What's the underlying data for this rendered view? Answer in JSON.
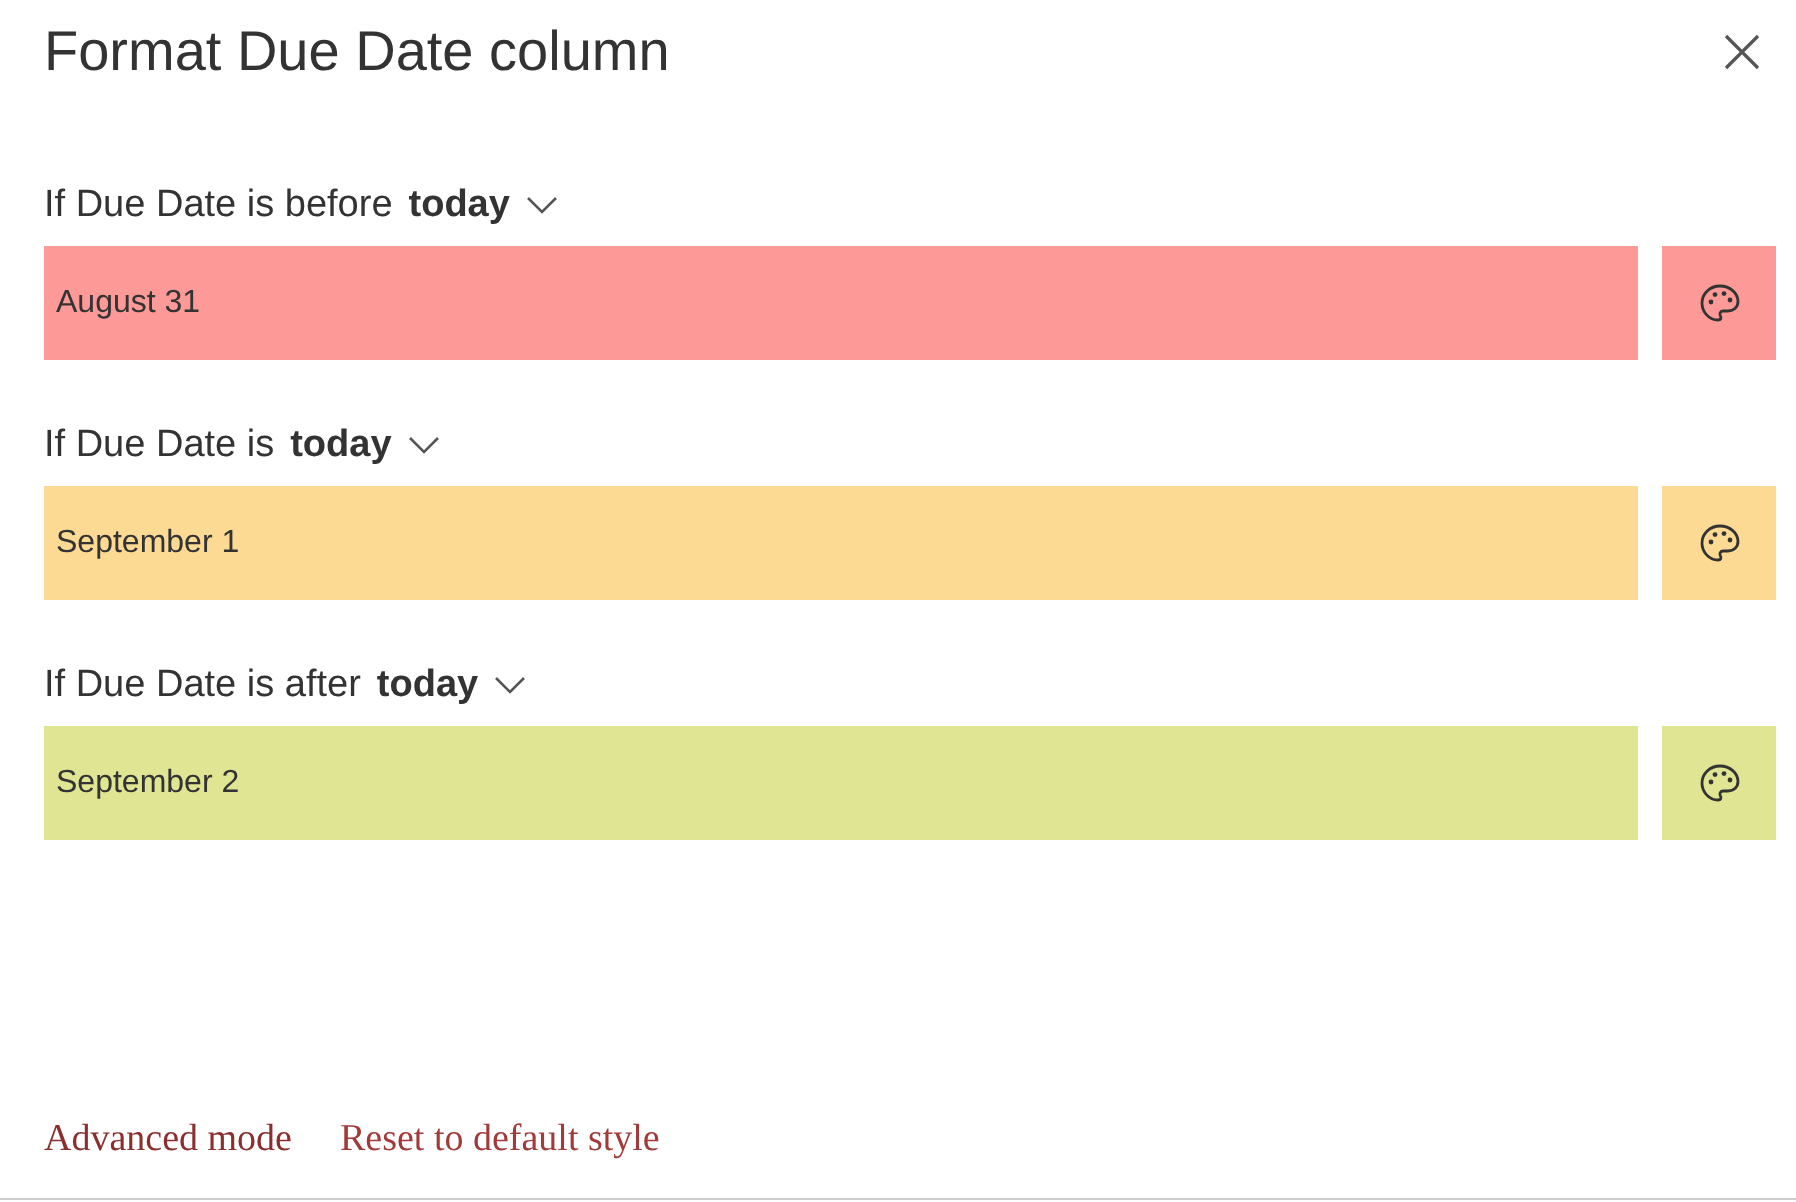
{
  "window": {
    "title": "Format Due Date column"
  },
  "rules": [
    {
      "prefix": "If Due Date is before",
      "value": "today",
      "sample": "August 31",
      "color": "#fd9996"
    },
    {
      "prefix": "If Due Date is",
      "value": "today",
      "sample": "September 1",
      "color": "#fdda94"
    },
    {
      "prefix": "If Due Date is after",
      "value": "today",
      "sample": "September 2",
      "color": "#dfe593"
    }
  ],
  "links": [
    "Advanced mode",
    "Reset to default style"
  ]
}
